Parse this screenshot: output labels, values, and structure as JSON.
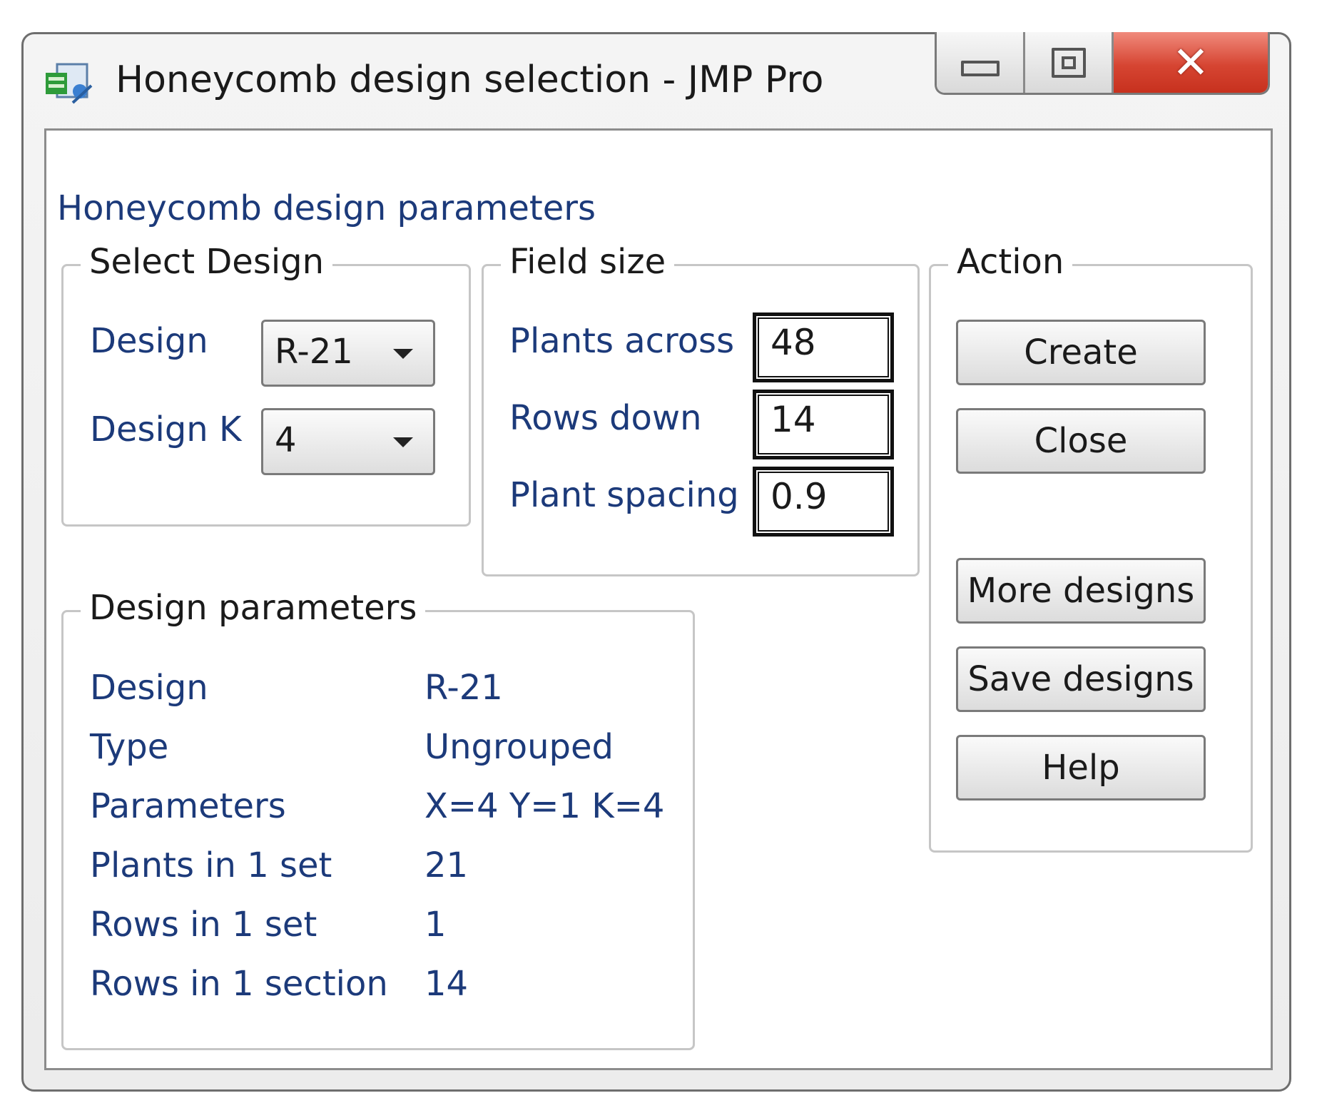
{
  "window": {
    "title": "Honeycomb design selection - JMP Pro"
  },
  "caption_buttons": {
    "minimize": "minimize-icon",
    "maximize": "maximize-icon",
    "close": "close-icon"
  },
  "heading": "Honeycomb design parameters",
  "select_design": {
    "legend": "Select Design",
    "design_label": "Design",
    "design_value": "R-21",
    "design_k_label": "Design K",
    "design_k_value": "4"
  },
  "field_size": {
    "legend": "Field size",
    "plants_across_label": "Plants across",
    "plants_across_value": "48",
    "rows_down_label": "Rows down",
    "rows_down_value": "14",
    "plant_spacing_label": "Plant spacing",
    "plant_spacing_value": "0.9"
  },
  "action": {
    "legend": "Action",
    "create": "Create",
    "close": "Close",
    "more_designs": "More designs",
    "save_designs": "Save designs",
    "help": "Help"
  },
  "design_parameters": {
    "legend": "Design parameters",
    "rows": [
      {
        "name": "Design",
        "value": "R-21"
      },
      {
        "name": "Type",
        "value": "Ungrouped"
      },
      {
        "name": "Parameters",
        "value": "X=4 Y=1 K=4"
      },
      {
        "name": "Plants in 1 set",
        "value": "21"
      },
      {
        "name": "Rows in 1 set",
        "value": "1"
      },
      {
        "name": "Rows in 1 section",
        "value": "14"
      }
    ]
  },
  "colors": {
    "label_text": "#1c3a7a",
    "close_button": "#d64532"
  }
}
